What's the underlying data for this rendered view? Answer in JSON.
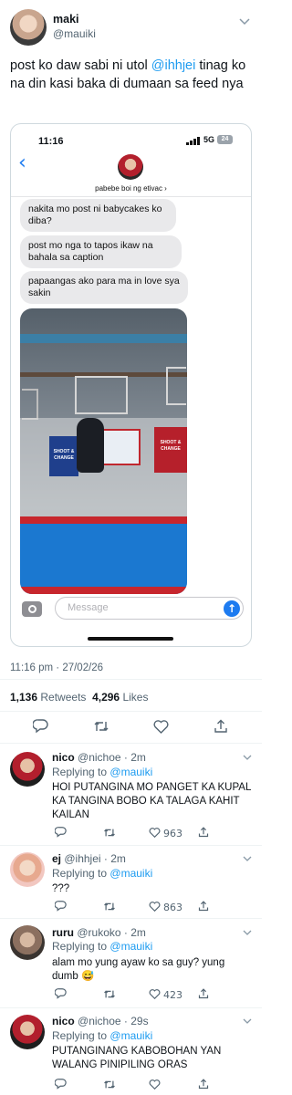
{
  "tweet": {
    "name": "maki",
    "handle": "@mauiki",
    "text_before": "post ko daw sabi ni utol ",
    "mention": "@ihhjei",
    "text_after": " tinag ko na din kasi baka di dumaan sa feed nya",
    "timestamp": "11:16 pm · 27/02/26",
    "retweets_count": "1,136",
    "retweets_label": "Retweets",
    "likes_count": "4,296",
    "likes_label": "Likes"
  },
  "screenshot": {
    "time": "11:16",
    "network": "5G",
    "battery": "24",
    "contact_name": "pabebe boi ng etivac ›",
    "messages": [
      "nakita mo post ni babycakes ko diba?",
      "post mo nga to tapos ikaw na bahala sa caption",
      "papaangas ako para ma in love sya sakin"
    ],
    "photo_banner_1": "SHOOT & CHANGE",
    "photo_banner_3": "SHOOT & CHANGE",
    "message_placeholder": "Message"
  },
  "actions": {
    "reply_icon": "reply-icon",
    "retweet_icon": "retweet-icon",
    "like_icon": "heart-icon",
    "share_icon": "share-icon"
  },
  "replies": [
    {
      "name": "nico",
      "handle": "@nichoe",
      "time": "· 2m",
      "replying_label": "Replying to",
      "replying_to": "@mauiki",
      "text": "HOI PUTANGINA MO PANGET KA KUPAL KA TANGINA BOBO KA TALAGA KAHIT KAILAN",
      "likes": "963"
    },
    {
      "name": "ej",
      "handle": "@ihhjei",
      "time": "· 2m",
      "replying_label": "Replying to",
      "replying_to": "@mauiki",
      "text": "???",
      "likes": "863"
    },
    {
      "name": "ruru",
      "handle": "@rukoko",
      "time": "· 2m",
      "replying_label": "Replying to",
      "replying_to": "@mauiki",
      "text": "alam mo yung ayaw ko sa guy? yung dumb 😅",
      "likes": "423"
    },
    {
      "name": "nico",
      "handle": "@nichoe",
      "time": "· 29s",
      "replying_label": "Replying to",
      "replying_to": "@mauiki",
      "text": "PUTANGINANG KABOBOHAN YAN WALANG PINIPILING ORAS",
      "likes": ""
    }
  ],
  "colors": {
    "accent": "#1d9bf0",
    "imessage_blue": "#1d7bf0",
    "text": "#0f1419",
    "muted": "#536471"
  }
}
